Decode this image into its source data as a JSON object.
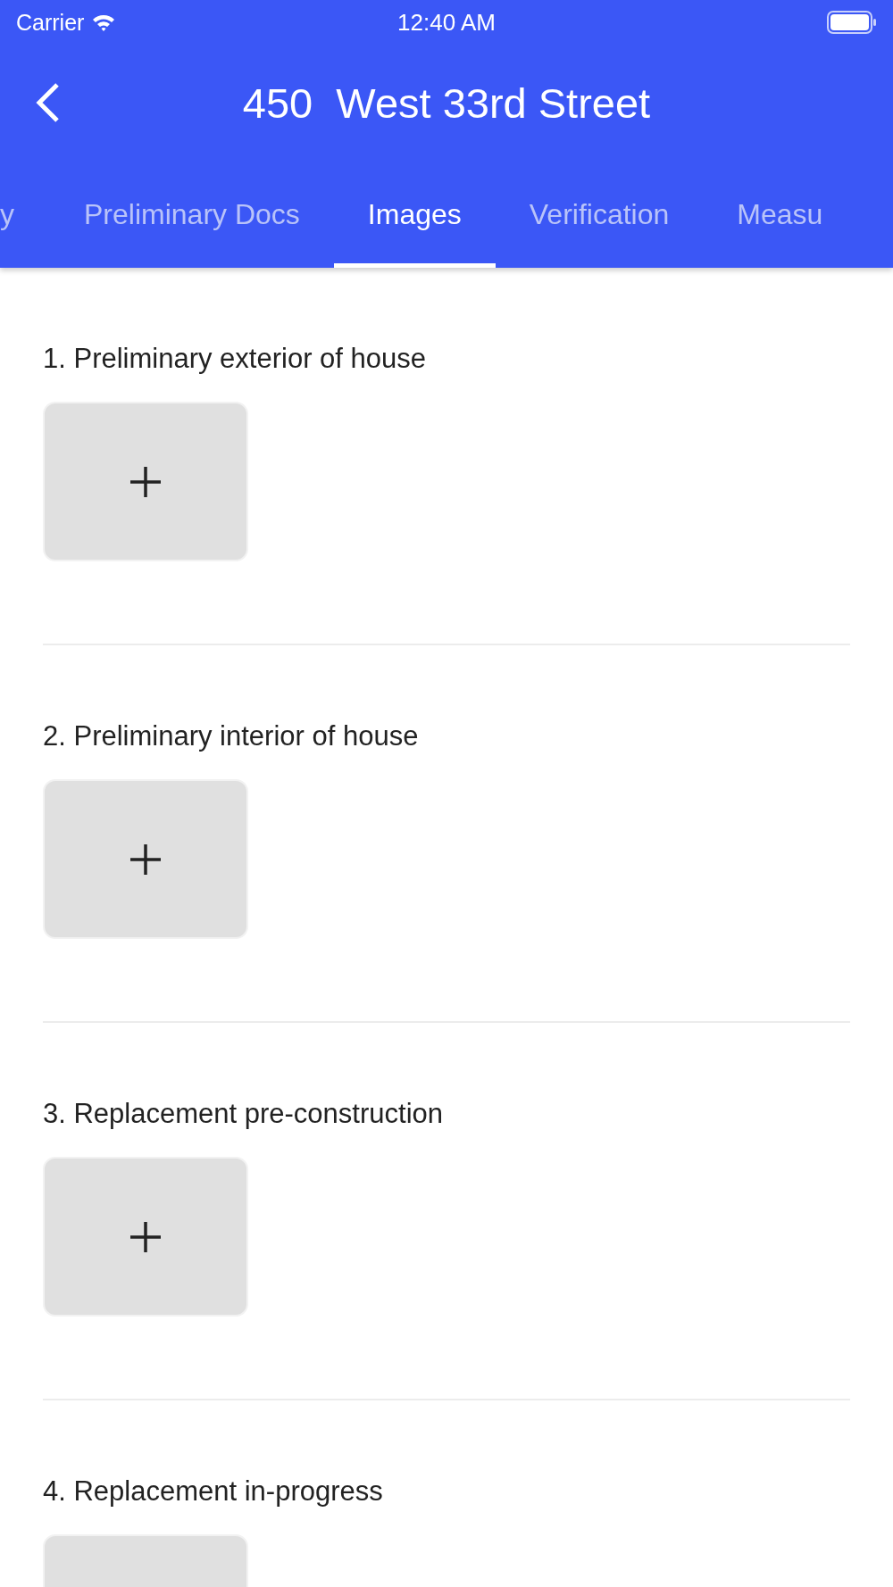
{
  "status_bar": {
    "carrier": "Carrier",
    "time": "12:40 AM"
  },
  "header": {
    "title": "450  West 33rd Street"
  },
  "tabs": [
    {
      "label": "y",
      "selected": false
    },
    {
      "label": "Preliminary Docs",
      "selected": false
    },
    {
      "label": "Images",
      "selected": true
    },
    {
      "label": "Verification",
      "selected": false
    },
    {
      "label": "Measu",
      "selected": false
    }
  ],
  "sections": [
    {
      "title": "1. Preliminary exterior of house"
    },
    {
      "title": "2. Preliminary interior of house"
    },
    {
      "title": "3. Replacement pre-construction"
    },
    {
      "title": "4. Replacement in-progress"
    }
  ]
}
